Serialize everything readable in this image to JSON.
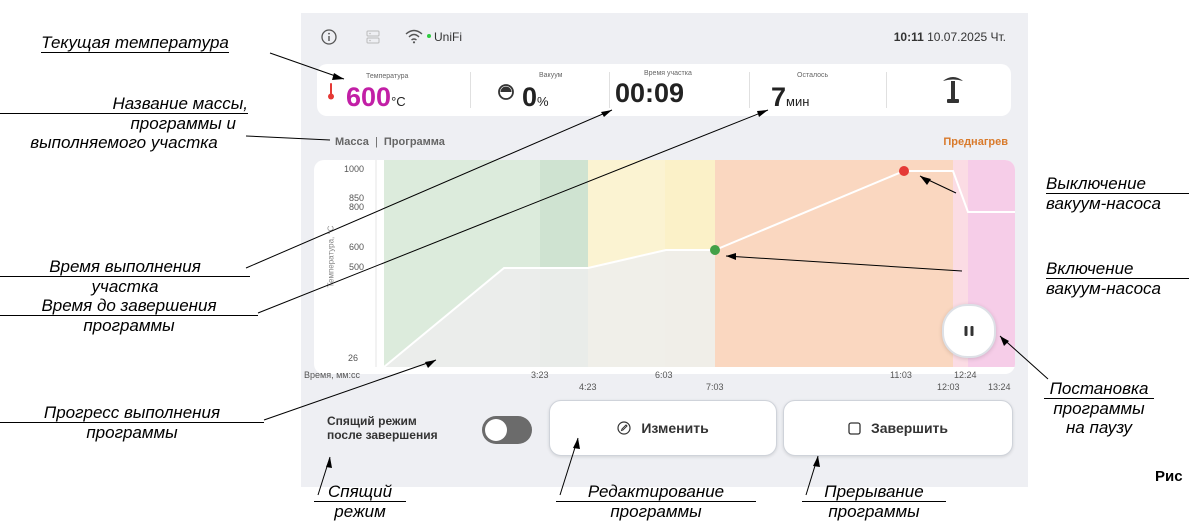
{
  "status_bar": {
    "wifi_name": "UniFi",
    "time": "10:11",
    "date": "10.07.2025 Чт."
  },
  "metrics": {
    "temperature": {
      "label": "Температура",
      "value": "600",
      "unit": "°C"
    },
    "vacuum": {
      "label": "Вакуум",
      "value": "0",
      "unit": "%"
    },
    "segment_time": {
      "label": "Время участка",
      "value": "00:09"
    },
    "remaining": {
      "label": "Осталось",
      "value": "7",
      "unit": "мин"
    }
  },
  "breadcrumb": {
    "mass": "Масса",
    "separator": "|",
    "program": "Программа"
  },
  "phase": "Преднагрев",
  "sleep_toggle": {
    "label_line1": "Спящий режим",
    "label_line2": "после завершения"
  },
  "buttons": {
    "edit": "Изменить",
    "finish": "Завершить"
  },
  "colors": {
    "temp_accent": "#c21fa6",
    "phase_color": "#d97a2b",
    "pump_off": "#e53935",
    "pump_on": "#43a047"
  },
  "chart_data": {
    "type": "line",
    "ylabel": "Температура, °С",
    "xlabel": "Время, мм:сс",
    "y_ticks": [
      "1000",
      "850",
      "800",
      "600",
      "500",
      "26"
    ],
    "x_ticks": [
      "3:23",
      "4:23",
      "6:03",
      "7:03",
      "11:03",
      "12:03",
      "12:24",
      "13:24"
    ],
    "series": [
      {
        "x": [
          "0:00",
          "3:23",
          "4:23",
          "6:03",
          "7:03",
          "11:03",
          "12:03",
          "12:24",
          "13:24"
        ],
        "y": [
          26,
          500,
          500,
          600,
          600,
          1000,
          1000,
          800,
          800
        ]
      }
    ],
    "markers": [
      {
        "x": "7:03",
        "y": 600,
        "meaning": "pump on"
      },
      {
        "x": "11:03",
        "y": 1000,
        "meaning": "pump off"
      }
    ]
  },
  "callouts": {
    "current_temp": "Текущая температура",
    "names_1": "Название массы,",
    "names_2": "программы и",
    "names_3": "выполняемого участка",
    "segment_time_1": "Время выполнения",
    "segment_time_2": "участка",
    "remaining_1": "Время до завершения",
    "remaining_2": "программы",
    "progress_1": "Прогресс выполнения",
    "progress_2": "программы",
    "sleep_1": "Спящий",
    "sleep_2": "режим",
    "edit_1": "Редактирование",
    "edit_2": "программы",
    "abort_1": "Прерывание",
    "abort_2": "программы",
    "pump_off_1": "Выключение",
    "pump_off_2": "вакуум-насоса",
    "pump_on_1": "Включение",
    "pump_on_2": "вакуум-насоса",
    "pause_1": "Постановка",
    "pause_2": "программы",
    "pause_3": "на паузу",
    "figure_stub": "Рис"
  }
}
